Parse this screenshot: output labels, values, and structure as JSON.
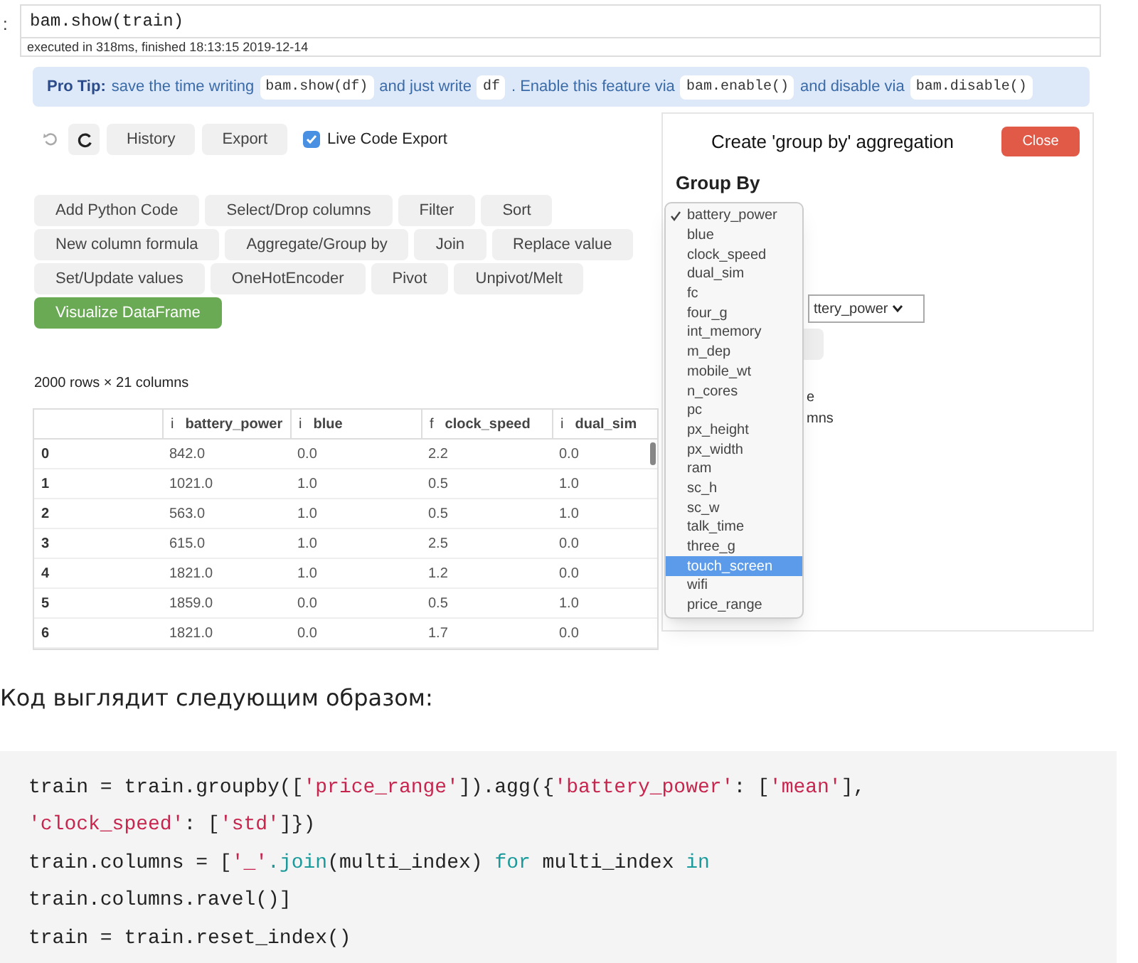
{
  "notebook_cell": {
    "prompt": ":",
    "input": "bam.show(train)",
    "execution_info": "executed in 318ms, finished 18:13:15 2019-12-14"
  },
  "pro_tip": {
    "parts": [
      {
        "kind": "label",
        "text": "Pro Tip:"
      },
      {
        "kind": "text",
        "text": "save the time writing"
      },
      {
        "kind": "code",
        "text": "bam.show(df)"
      },
      {
        "kind": "text",
        "text": "and just write"
      },
      {
        "kind": "code",
        "text": "df"
      },
      {
        "kind": "text",
        "text": ". Enable this feature via"
      },
      {
        "kind": "code",
        "text": "bam.enable()"
      },
      {
        "kind": "text",
        "text": "and disable via"
      },
      {
        "kind": "code",
        "text": "bam.disable()"
      }
    ]
  },
  "toolbar": {
    "undo_disabled": true,
    "buttons": [
      "History",
      "Export"
    ],
    "live_code_export": {
      "label": "Live Code Export",
      "checked": true
    }
  },
  "actions": [
    [
      "Add Python Code",
      "Select/Drop columns",
      "Filter",
      "Sort"
    ],
    [
      "New column formula",
      "Aggregate/Group by",
      "Join",
      "Replace value"
    ],
    [
      "Set/Update values",
      "OneHotEncoder",
      "Pivot",
      "Unpivot/Melt"
    ]
  ],
  "primary_action": "Visualize DataFrame",
  "table": {
    "shape": "2000 rows × 21 columns",
    "columns": [
      {},
      {
        "type": "i",
        "name": "battery_power"
      },
      {
        "type": "i",
        "name": "blue"
      },
      {
        "type": "f",
        "name": "clock_speed"
      },
      {
        "type": "i",
        "name": "dual_sim"
      }
    ],
    "rows": [
      [
        "0",
        "842.0",
        "0.0",
        "2.2",
        "0.0"
      ],
      [
        "1",
        "1021.0",
        "1.0",
        "0.5",
        "1.0"
      ],
      [
        "2",
        "563.0",
        "1.0",
        "0.5",
        "1.0"
      ],
      [
        "3",
        "615.0",
        "1.0",
        "2.5",
        "0.0"
      ],
      [
        "4",
        "1821.0",
        "1.0",
        "1.2",
        "0.0"
      ],
      [
        "5",
        "1859.0",
        "0.0",
        "0.5",
        "1.0"
      ],
      [
        "6",
        "1821.0",
        "0.0",
        "1.7",
        "0.0"
      ]
    ]
  },
  "panel": {
    "title": "Create 'group by' aggregation",
    "close": "Close",
    "group_by_label": "Group By",
    "hidden_select_value": "ttery_power",
    "hidden_text_1": "e",
    "hidden_text_2": "mns",
    "dropdown": [
      {
        "label": "battery_power",
        "checked": true,
        "selected": false
      },
      {
        "label": "blue",
        "checked": false,
        "selected": false
      },
      {
        "label": "clock_speed",
        "checked": false,
        "selected": false
      },
      {
        "label": "dual_sim",
        "checked": false,
        "selected": false
      },
      {
        "label": "fc",
        "checked": false,
        "selected": false
      },
      {
        "label": "four_g",
        "checked": false,
        "selected": false
      },
      {
        "label": "int_memory",
        "checked": false,
        "selected": false
      },
      {
        "label": "m_dep",
        "checked": false,
        "selected": false
      },
      {
        "label": "mobile_wt",
        "checked": false,
        "selected": false
      },
      {
        "label": "n_cores",
        "checked": false,
        "selected": false
      },
      {
        "label": "pc",
        "checked": false,
        "selected": false
      },
      {
        "label": "px_height",
        "checked": false,
        "selected": false
      },
      {
        "label": "px_width",
        "checked": false,
        "selected": false
      },
      {
        "label": "ram",
        "checked": false,
        "selected": false
      },
      {
        "label": "sc_h",
        "checked": false,
        "selected": false
      },
      {
        "label": "sc_w",
        "checked": false,
        "selected": false
      },
      {
        "label": "talk_time",
        "checked": false,
        "selected": false
      },
      {
        "label": "three_g",
        "checked": false,
        "selected": false
      },
      {
        "label": "touch_screen",
        "checked": false,
        "selected": true
      },
      {
        "label": "wifi",
        "checked": false,
        "selected": false
      },
      {
        "label": "price_range",
        "checked": false,
        "selected": false
      }
    ]
  },
  "article_text": "Код выглядит следующим образом:",
  "code_block": [
    [
      {
        "kind": "plain",
        "text": "train = train.groupby(["
      },
      {
        "kind": "string",
        "text": "'price_range'"
      },
      {
        "kind": "plain",
        "text": "]).agg({"
      },
      {
        "kind": "string",
        "text": "'battery_power'"
      },
      {
        "kind": "plain",
        "text": ": ["
      },
      {
        "kind": "string",
        "text": "'mean'"
      },
      {
        "kind": "plain",
        "text": "],"
      }
    ],
    [
      {
        "kind": "string",
        "text": "'clock_speed'"
      },
      {
        "kind": "plain",
        "text": ": ["
      },
      {
        "kind": "string",
        "text": "'std'"
      },
      {
        "kind": "plain",
        "text": "]})"
      }
    ],
    [
      {
        "kind": "plain",
        "text": "train.columns = ["
      },
      {
        "kind": "string",
        "text": "'_'"
      },
      {
        "kind": "keyword",
        "text": ".join"
      },
      {
        "kind": "plain",
        "text": "(multi_index) "
      },
      {
        "kind": "keyword",
        "text": "for"
      },
      {
        "kind": "plain",
        "text": " multi_index "
      },
      {
        "kind": "keyword",
        "text": "in"
      }
    ],
    [
      {
        "kind": "plain",
        "text": "train.columns.ravel()]"
      }
    ],
    [
      {
        "kind": "plain",
        "text": "train = train.reset_index()"
      }
    ]
  ]
}
